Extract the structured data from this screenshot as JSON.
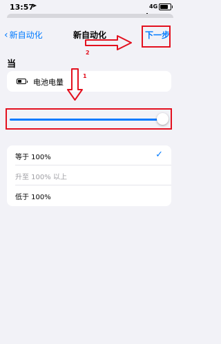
{
  "status_bar": {
    "time": "13:57",
    "location_arrow": "location-arrow-icon",
    "network": "4G"
  },
  "nav": {
    "back_label": "新自动化",
    "title": "新自动化",
    "next_label": "下一步"
  },
  "section_title": "当",
  "trigger": {
    "label": "电池电量",
    "icon": "battery-icon"
  },
  "slider": {
    "value_fraction": 1.0
  },
  "options": [
    {
      "label": "等于 100%",
      "selected": true,
      "disabled": false
    },
    {
      "label": "升至 100% 以上",
      "selected": false,
      "disabled": true
    },
    {
      "label": "低于 100%",
      "selected": false,
      "disabled": false
    }
  ],
  "annotations": {
    "step1": "1",
    "step2": "2"
  },
  "colors": {
    "accent": "#007aff",
    "annotation": "#e3101e",
    "background": "#f2f2f7"
  }
}
